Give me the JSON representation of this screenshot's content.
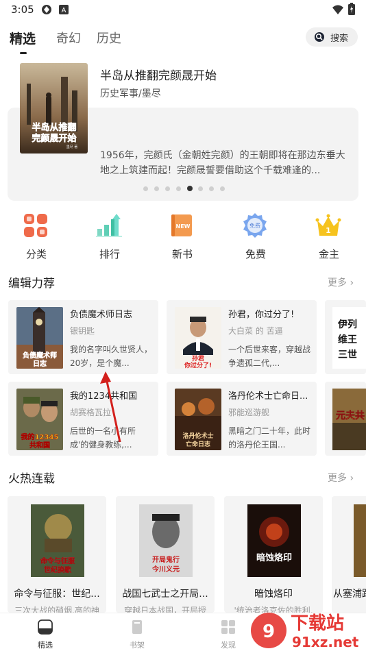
{
  "status": {
    "time": "3:05"
  },
  "tabs": [
    {
      "label": "精选",
      "active": true
    },
    {
      "label": "奇幻",
      "active": false
    },
    {
      "label": "历史",
      "active": false
    }
  ],
  "search": {
    "label": "搜索",
    "icon": "search-icon"
  },
  "banner": {
    "title": "半岛从推翻完颜晟开始",
    "subtitle": "历史军事/墨尽",
    "desc": "1956年，完颜氏（金朝姓完颜）的王朝即将在那边东垂大地之上筑建而起！完颜晟誓要借助这个千载难逢的...",
    "cover_text": "半岛从推翻完颜晟开始",
    "cover_author": "墨尽 著",
    "page_count": 8,
    "active_page": 5
  },
  "quick_links": [
    {
      "label": "分类",
      "icon": "category-icon"
    },
    {
      "label": "排行",
      "icon": "ranking-icon"
    },
    {
      "label": "新书",
      "icon": "new-book-icon"
    },
    {
      "label": "免费",
      "icon": "free-icon"
    },
    {
      "label": "金主",
      "icon": "crown-icon"
    }
  ],
  "editor_picks": {
    "title": "编辑力荐",
    "more": "更多 ›",
    "books": [
      {
        "title": "负债魔术师日志",
        "author": "银钥匙",
        "desc": "我的名字叫久世贤人，20岁，是个魔...",
        "cover_text": "负债魔术师日志"
      },
      {
        "title": "孙君，你过分了!",
        "author": "大白菜 的 苦逼",
        "desc": "一个后世来客，穿越战争遗孤二代,...",
        "cover_text": "孙君你过分了"
      },
      {
        "title": "我的1234共和国",
        "author": "胡赛格瓦拉",
        "desc": "后世的一名小有所成'的健身教练,...",
        "cover_text": "我的1234共和国"
      },
      {
        "title": "洛丹伦术士亡命日...",
        "author": "邪能巡游舰",
        "desc": "黑暗之门二十年，此时的洛丹伦王国...",
        "cover_text": "洛丹伦术士亡命日志"
      }
    ],
    "partial_covers": [
      "伊列维王三世",
      "元夫共"
    ]
  },
  "hot_serials": {
    "title": "火热连载",
    "more": "更多 ›",
    "books": [
      {
        "title": "命令与征服：世纪...",
        "desc": "三次大战的硝烟,高的神",
        "cover_text": "命令与征服世纪换歌"
      },
      {
        "title": "战国七武士之开局...",
        "desc": "穿越日本战国，开局授",
        "cover_text": "开局鬼行今川义元"
      },
      {
        "title": "暗蚀烙印",
        "desc": "'统治者洛克佐的胜利,",
        "cover_text": "暗蚀烙印"
      },
      {
        "title": "从塞浦路",
        "desc": "",
        "cover_text": ""
      }
    ]
  },
  "bottom_nav": [
    {
      "label": "精选",
      "icon": "featured-icon",
      "active": true
    },
    {
      "label": "书架",
      "icon": "bookshelf-icon",
      "active": false
    },
    {
      "label": "发现",
      "icon": "discover-icon",
      "active": false
    }
  ],
  "watermark": {
    "line1": "下载站",
    "line2": "91xz.net"
  }
}
